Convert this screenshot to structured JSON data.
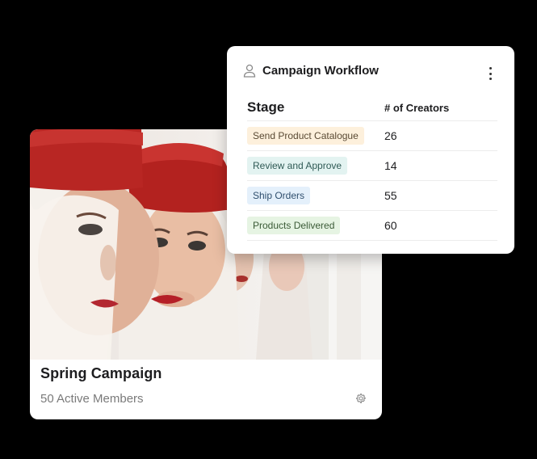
{
  "campaign_card": {
    "title": "Spring Campaign",
    "members": "50 Active Members",
    "settings_icon": "gear-icon"
  },
  "workflow": {
    "title": "Campaign Workflow",
    "header_icon": "user-icon",
    "menu_icon": "kebab-menu-icon",
    "columns": {
      "stage": "Stage",
      "count": "# of Creators"
    },
    "rows": [
      {
        "stage": "Send Product Catalogue",
        "count": "26",
        "color": "#fdf0dc"
      },
      {
        "stage": "Review and Approve",
        "count": "14",
        "color": "#e3f3f1"
      },
      {
        "stage": "Ship Orders",
        "count": "55",
        "color": "#e4f0fb"
      },
      {
        "stage": "Products Delivered",
        "count": "60",
        "color": "#e6f4e3"
      }
    ]
  }
}
